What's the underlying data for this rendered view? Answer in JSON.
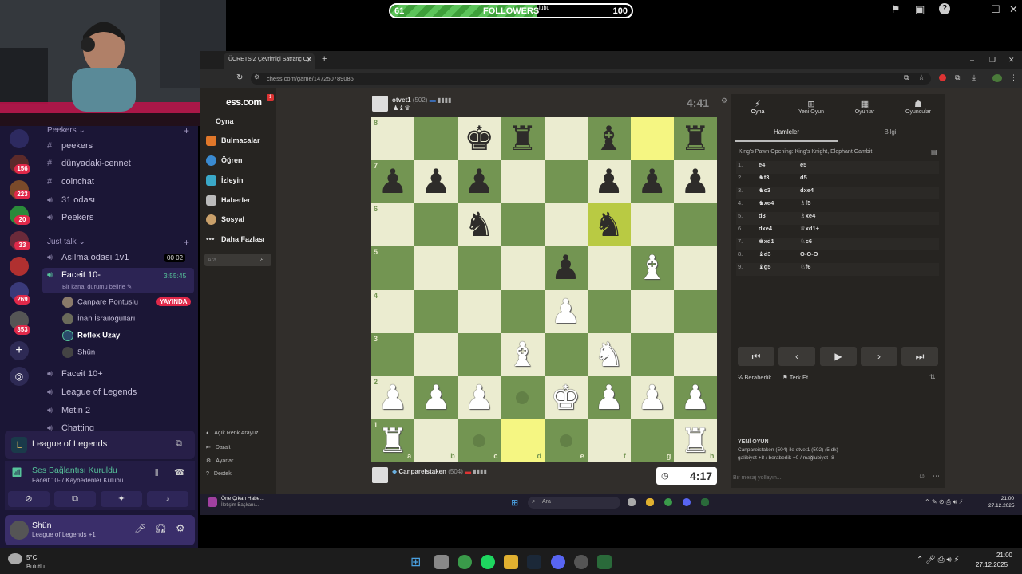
{
  "stream": {
    "followers_label": "FOLLOWERS",
    "followers_current": "61",
    "followers_goal": "100",
    "followers_progress": 0.61,
    "goal_sub": "lübü"
  },
  "discord": {
    "badges": [
      "156",
      "223",
      "20",
      "33",
      "269",
      "353"
    ],
    "categories": {
      "peekers": "Peekers",
      "just_talk": "Just talk"
    },
    "text_channels": [
      "peekers",
      "dünyadaki-cennet",
      "coinchat"
    ],
    "voice_channels_top": [
      "31 odası",
      "Peekers"
    ],
    "voice_channel_asilma": "Asılma odası 1v1",
    "asilma_counts": [
      "00",
      "02"
    ],
    "active_channel": "Faceit 10-",
    "active_time": "3:55:45",
    "active_status": "Bir kanal durumu belirle",
    "voice_users": [
      "Canpare Pontuslu",
      "İnan İsrailoğulları",
      "Reflex Uzay",
      "Shün"
    ],
    "live_badge": "YAYINDA",
    "voice_channels_bottom": [
      "Faceit 10+",
      "League of Legends",
      "Metin 2",
      "Chatting"
    ],
    "activity_game": "League of Legends",
    "voice_status": "Ses Bağlantısı Kuruldu",
    "voice_location": "Faceit 10- / Kaybedenler Kulübü",
    "user_name": "Shün",
    "user_activity": "League of Legends +1"
  },
  "browser": {
    "tab_title": "ÜCRETSİZ Çevrimiçi Satranç Oy",
    "url": "chess.com/game/147250789086"
  },
  "chesscom": {
    "logo": "ess.com",
    "nav": [
      "Oyna",
      "Bulmacalar",
      "Öğren",
      "İzleyin",
      "Haberler",
      "Sosyal",
      "Daha Fazlası"
    ],
    "search_placeholder": "Ara",
    "footer": [
      "Açık Renk Arayüz",
      "Daralt",
      "Ayarlar",
      "Destek"
    ],
    "notif_badge": "1"
  },
  "game": {
    "top_player": "otvet1",
    "top_rating": "(502)",
    "top_clock": "4:41",
    "bottom_player": "Canpareistaken",
    "bottom_rating": "(504)",
    "bottom_clock": "4:17",
    "files": [
      "a",
      "b",
      "c",
      "d",
      "e",
      "f",
      "g",
      "h"
    ],
    "ranks": [
      "8",
      "7",
      "6",
      "5",
      "4",
      "3",
      "2",
      "1"
    ],
    "board": [
      [
        "",
        "",
        "bk",
        "br",
        "",
        "bb",
        "",
        "br"
      ],
      [
        "bp",
        "bp",
        "bp",
        "",
        "",
        "bp",
        "bp",
        "bp"
      ],
      [
        "",
        "",
        "bn",
        "",
        "",
        "bn",
        "",
        ""
      ],
      [
        "",
        "",
        "",
        "",
        "bp",
        "",
        "wb",
        ""
      ],
      [
        "",
        "",
        "",
        "",
        "wp",
        "",
        "",
        ""
      ],
      [
        "",
        "",
        "",
        "wb",
        "",
        "wn",
        "",
        ""
      ],
      [
        "wp",
        "wp",
        "wp",
        "",
        "wk",
        "wp",
        "wp",
        "wp"
      ],
      [
        "wr",
        "",
        "",
        "",
        "",
        "",
        "",
        "wr"
      ]
    ],
    "highlights": [
      "g8",
      "f6",
      "d1"
    ],
    "move_dots": [
      "d2",
      "c1",
      "e1"
    ]
  },
  "panel": {
    "top_tabs": [
      "Oyna",
      "Yeni Oyun",
      "Oyunlar",
      "Oyuncular"
    ],
    "sub_tabs": [
      "Hamleler",
      "Bilgi"
    ],
    "opening": "King's Pawn Opening: King's Knight, Elephant Gambit",
    "moves": [
      {
        "n": "1.",
        "w": "e4",
        "b": "e5"
      },
      {
        "n": "2.",
        "w": "♞f3",
        "b": "d5"
      },
      {
        "n": "3.",
        "w": "♞c3",
        "b": "dxe4"
      },
      {
        "n": "4.",
        "w": "♞xe4",
        "b": "♗f5"
      },
      {
        "n": "5.",
        "w": "d3",
        "b": "♗xe4"
      },
      {
        "n": "6.",
        "w": "dxe4",
        "b": "♕xd1+"
      },
      {
        "n": "7.",
        "w": "♚xd1",
        "b": "♘c6"
      },
      {
        "n": "8.",
        "w": "♝d3",
        "b": "O-O-O"
      },
      {
        "n": "9.",
        "w": "♝g5",
        "b": "♘f6"
      }
    ],
    "draw_label": "Beraberlik",
    "resign_label": "Terk Et",
    "new_game_title": "YENİ OYUN",
    "new_game_line1": "Canpareistaken (504) ile otvet1 (502) (5 dk)",
    "new_game_line2": "galibiyet +8 / beraberlik +0 / mağlubiyet -8",
    "chat_placeholder": "Bir mesaj yollayın..."
  },
  "inner_taskbar": {
    "news_title": "Öne Çıkan Habe...",
    "news_sub": "İletişim Başkanı...",
    "search": "Ara",
    "time": "21:00",
    "date": "27.12.2025"
  },
  "taskbar": {
    "weather_temp": "5°C",
    "weather_desc": "Bulutlu",
    "time": "21:00",
    "date": "27.12.2025"
  }
}
